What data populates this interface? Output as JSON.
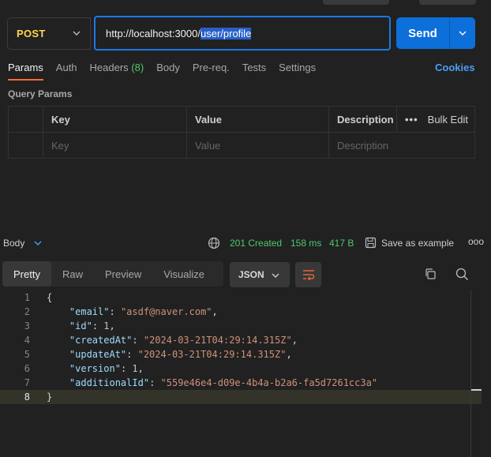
{
  "request": {
    "method": "POST",
    "url_prefix": "http://localhost:3000/",
    "url_selected": "user/profile",
    "send_label": "Send"
  },
  "tabs": [
    {
      "label": "Params",
      "active": true
    },
    {
      "label": "Auth"
    },
    {
      "label": "Headers",
      "count": "(8)"
    },
    {
      "label": "Body"
    },
    {
      "label": "Pre-req."
    },
    {
      "label": "Tests"
    },
    {
      "label": "Settings"
    }
  ],
  "cookies_label": "Cookies",
  "query_params": {
    "title": "Query Params",
    "headers": {
      "key": "Key",
      "value": "Value",
      "description": "Description"
    },
    "placeholders": {
      "key": "Key",
      "value": "Value",
      "description": "Description"
    },
    "bulk_edit": "Bulk Edit",
    "more": "•••"
  },
  "response": {
    "body_label": "Body",
    "status": "201 Created",
    "time": "158 ms",
    "size": "417 B",
    "save_label": "Save as example",
    "more": "ooo",
    "view_tabs": [
      "Pretty",
      "Raw",
      "Preview",
      "Visualize"
    ],
    "format": "JSON",
    "lines": [
      {
        "num": "1",
        "text": "{"
      },
      {
        "num": "2",
        "key": "\"email\"",
        "value": "\"asdf@naver.com\"",
        "type": "s",
        "comma": ","
      },
      {
        "num": "3",
        "key": "\"id\"",
        "value": "1",
        "type": "n",
        "comma": ","
      },
      {
        "num": "4",
        "key": "\"createdAt\"",
        "value": "\"2024-03-21T04:29:14.315Z\"",
        "type": "s",
        "comma": ","
      },
      {
        "num": "5",
        "key": "\"updateAt\"",
        "value": "\"2024-03-21T04:29:14.315Z\"",
        "type": "s",
        "comma": ","
      },
      {
        "num": "6",
        "key": "\"version\"",
        "value": "1",
        "type": "n",
        "comma": ","
      },
      {
        "num": "7",
        "key": "\"additionalId\"",
        "value": "\"559e46e4-d09e-4b4a-b2a6-fa5d7261cc3a\"",
        "type": "s",
        "comma": ""
      },
      {
        "num": "8",
        "text": "}"
      }
    ]
  }
}
